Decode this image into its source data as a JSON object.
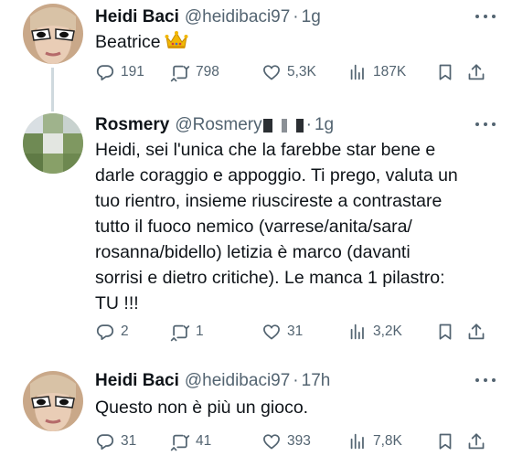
{
  "tweets": [
    {
      "name": "Heidi Baci",
      "handle": "@heidibaci97",
      "separator": "·",
      "time": "1g",
      "text_lines": [
        "Beatrice"
      ],
      "emoji": "crown-emoji",
      "replies": "191",
      "retweets": "798",
      "likes": "5,3K",
      "views": "187K"
    },
    {
      "name": "Rosmery",
      "handle": "@Rosmery",
      "separator": "·",
      "time": "1g",
      "text_lines": [
        "Heidi, sei l'unica che la farebbe star bene e",
        "darle coraggio e appoggio. Ti prego, valuta un",
        "tuo rientro, insieme riuscireste a contrastare",
        "tutto il fuoco nemico (varrese/anita/sara/",
        "rosanna/bidello) letizia è marco (davanti",
        "sorrisi e dietro critiche). Le manca 1 pilastro:",
        "TU !!!"
      ],
      "replies": "2",
      "retweets": "1",
      "likes": "31",
      "views": "3,2K"
    },
    {
      "name": "Heidi Baci",
      "handle": "@heidibaci97",
      "separator": "·",
      "time": "17h",
      "text_lines": [
        "Questo non è più un gioco."
      ],
      "replies": "31",
      "retweets": "41",
      "likes": "393",
      "views": "7,8K"
    }
  ],
  "icons": {
    "reply": "reply-icon",
    "retweet": "retweet-icon",
    "like": "heart-icon",
    "views": "views-icon",
    "bookmark": "bookmark-icon",
    "share": "share-icon",
    "more": "more-icon"
  },
  "colors": {
    "text": "#0f1419",
    "secondary": "#536471",
    "thread_line": "#cfd9de"
  }
}
